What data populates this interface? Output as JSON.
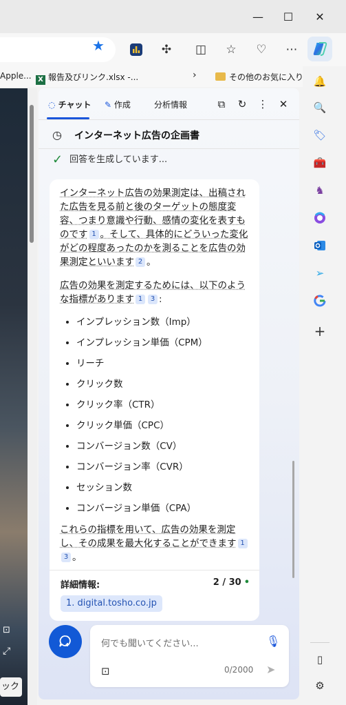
{
  "browser": {
    "bookmarks": [
      {
        "label": "Apple...",
        "icon": "bookmark-icon"
      },
      {
        "label": "報告及びリンク.xlsx -...",
        "icon": "excel-icon"
      },
      {
        "label": "その他のお気に入り",
        "icon": "folder-icon"
      }
    ],
    "page_button_label": "ック",
    "accent_color": "#1a56db"
  },
  "copilot": {
    "tabs": [
      {
        "label": "チャット",
        "active": true
      },
      {
        "label": "作成",
        "active": false
      },
      {
        "label": "分析情報",
        "active": false
      }
    ],
    "conversation_title": "インターネット広告の企画書",
    "status": "回答を生成しています...",
    "answer": {
      "para1": "インターネット広告の効果測定は、出稿された広告を見る前と後のターゲットの態度変容、つまり意識や行動、感情の変化を表すものです",
      "para1_cite": "1",
      "para1b": "。そして、具体的にどういった変化がどの程度あったのかを測ることを広告の効果測定といいます",
      "para1b_cite": "2",
      "para1b_end": "。",
      "para2": "広告の効果を測定するためには、以下のような指標があります",
      "para2_cites": [
        "1",
        "3"
      ],
      "para2_end": ":",
      "metrics": [
        "インプレッション数（Imp）",
        "インプレッション単価（CPM）",
        "リーチ",
        "クリック数",
        "クリック率（CTR）",
        "クリック単価（CPC）",
        "コンバージョン数（CV）",
        "コンバージョン率（CVR）",
        "セッション数",
        "コンバージョン単価（CPA）"
      ],
      "para3": "これらの指標を用いて、広告の効果を測定し、その成果を最大化することができます",
      "para3_cites": [
        "1",
        "3"
      ],
      "para3_end": "。"
    },
    "details": {
      "label": "詳細情報:",
      "count": "2 / 30",
      "source": "1. digital.tosho.co.jp"
    },
    "input": {
      "placeholder": "何でも聞いてください...",
      "char_count": "0/2000"
    }
  }
}
